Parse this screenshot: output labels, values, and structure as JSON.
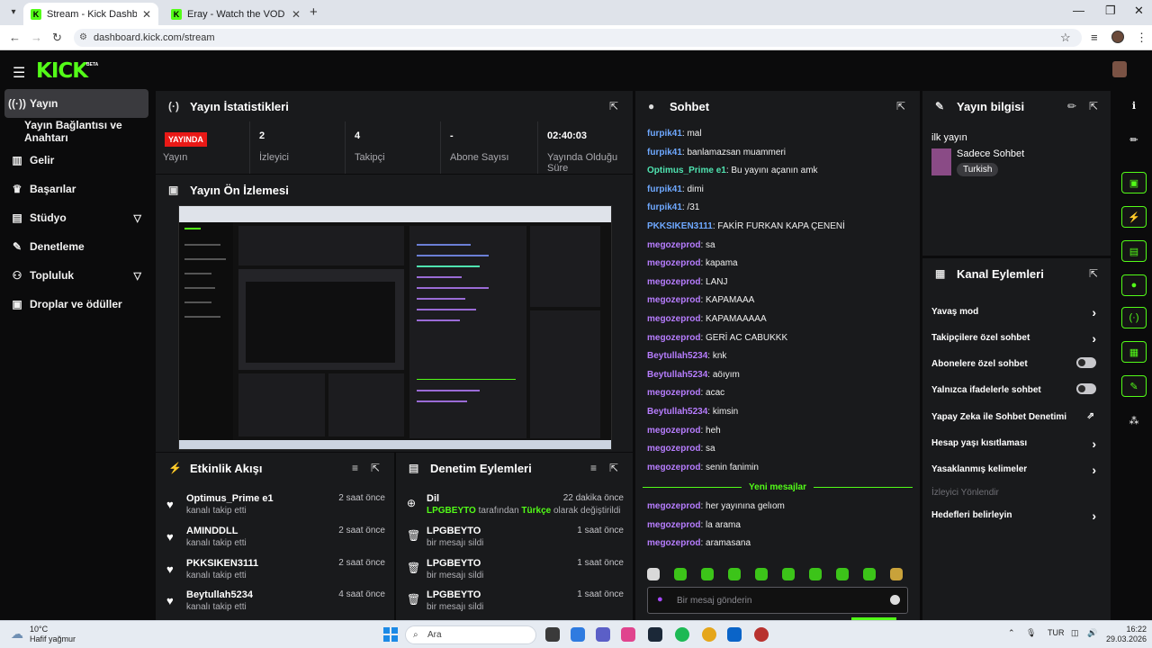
{
  "browser": {
    "tabs": [
      {
        "title": "Stream - Kick Dashboard"
      },
      {
        "title": "Eray - Watch the VOD on Kick"
      }
    ],
    "url": "dashboard.kick.com/stream"
  },
  "brand": {
    "logo": "KICK",
    "badge": "BETA",
    "accent": "#53fc18"
  },
  "sidebar": {
    "items": [
      {
        "label": "Yayın",
        "icon": "broadcast-icon"
      },
      {
        "label": "Yayın Bağlantısı ve Anahtarı"
      },
      {
        "label": "Gelir",
        "icon": "chart-icon"
      },
      {
        "label": "Başarılar",
        "icon": "trophy-icon"
      },
      {
        "label": "Stüdyo",
        "icon": "studio-icon"
      },
      {
        "label": "Denetleme",
        "icon": "wrench-icon"
      },
      {
        "label": "Topluluk",
        "icon": "community-icon"
      },
      {
        "label": "Droplar ve ödüller",
        "icon": "gift-icon"
      }
    ]
  },
  "stats": {
    "title": "Yayın İstatistikleri",
    "live_badge": "YAYINDA",
    "live_label": "Yayın",
    "viewers": "2",
    "viewers_label": "İzleyici",
    "followers": "4",
    "followers_label": "Takipçi",
    "subs": "-",
    "subs_label": "Abone Sayısı",
    "duration": "02:40:03",
    "duration_label": "Yayında Olduğu Süre"
  },
  "preview": {
    "title": "Yayın Ön İzlemesi"
  },
  "activity": {
    "title": "Etkinlik Akışı",
    "items": [
      {
        "name": "Optimus_Prime e1",
        "sub": "kanalı takip etti",
        "time": "2 saat önce"
      },
      {
        "name": "AMINDDLL",
        "sub": "kanalı takip etti",
        "time": "2 saat önce"
      },
      {
        "name": "PKKSIKEN3111",
        "sub": "kanalı takip etti",
        "time": "2 saat önce"
      },
      {
        "name": "Beytullah5234",
        "sub": "kanalı takip etti",
        "time": "4 saat önce"
      }
    ]
  },
  "moderation": {
    "title": "Denetim Eylemleri",
    "items": [
      {
        "name": "Dil",
        "user": "LPGBEYTO",
        "mid": " tarafından ",
        "lang": "Türkçe",
        "end": " olarak değiştirildi",
        "time": "22 dakika önce"
      },
      {
        "name": "LPGBEYTO",
        "sub": "bir mesajı sildi",
        "time": "1 saat önce"
      },
      {
        "name": "LPGBEYTO",
        "sub": "bir mesajı sildi",
        "time": "1 saat önce"
      },
      {
        "name": "LPGBEYTO",
        "sub": "bir mesajı sildi",
        "time": "1 saat önce"
      }
    ]
  },
  "chat": {
    "title": "Sohbet",
    "messages": [
      {
        "user": "furpik41",
        "color": "#6ea8ff",
        "text": ": mal"
      },
      {
        "user": "furpik41",
        "color": "#6ea8ff",
        "text": ": banlamazsan muammeri"
      },
      {
        "user": "Optimus_Prime e1",
        "color": "#4fe3b0",
        "text": ": Bu yayını açanın amk"
      },
      {
        "user": "furpik41",
        "color": "#6ea8ff",
        "text": ": dimi"
      },
      {
        "user": "furpik41",
        "color": "#6ea8ff",
        "text": ": /31"
      },
      {
        "user": "PKKSIKEN3111",
        "color": "#6ea8ff",
        "text": ": FAKİR FURKAN KAPA ÇENENİ"
      },
      {
        "user": "megozeprod",
        "color": "#b77dff",
        "text": ": sa"
      },
      {
        "user": "megozeprod",
        "color": "#b77dff",
        "text": ": kapama"
      },
      {
        "user": "megozeprod",
        "color": "#b77dff",
        "text": ": LANJ"
      },
      {
        "user": "megozeprod",
        "color": "#b77dff",
        "text": ": KAPAMAAA"
      },
      {
        "user": "megozeprod",
        "color": "#b77dff",
        "text": ": KAPAMAAAAA"
      },
      {
        "user": "megozeprod",
        "color": "#b77dff",
        "text": ": GERİ AC CABUKKK"
      },
      {
        "user": "Beytullah5234",
        "color": "#b77dff",
        "text": ": knk"
      },
      {
        "user": "Beytullah5234",
        "color": "#b77dff",
        "text": ": aöıyım"
      },
      {
        "user": "megozeprod",
        "color": "#b77dff",
        "text": ": acac"
      },
      {
        "user": "Beytullah5234",
        "color": "#b77dff",
        "text": ": kimsin"
      },
      {
        "user": "megozeprod",
        "color": "#b77dff",
        "text": ": heh"
      },
      {
        "user": "megozeprod",
        "color": "#b77dff",
        "text": ": sa"
      },
      {
        "user": "megozeprod",
        "color": "#b77dff",
        "text": ": senin fanimin"
      }
    ],
    "new_messages_label": "Yeni mesajlar",
    "new_messages": [
      {
        "user": "megozeprod",
        "color": "#b77dff",
        "text": ": her yayınına gelıom"
      },
      {
        "user": "megozeprod",
        "color": "#b77dff",
        "text": ": la arama"
      },
      {
        "user": "megozeprod",
        "color": "#b77dff",
        "text": ": aramasana"
      }
    ],
    "input_placeholder": "Bir mesaj gönderin"
  },
  "stream_info": {
    "title": "Yayın bilgisi",
    "stream_title": "ilk yayın",
    "category": "Sadece Sohbet",
    "tag": "Turkish"
  },
  "channel_actions": {
    "title": "Kanal Eylemleri",
    "items": [
      {
        "label": "Yavaş mod",
        "kind": "arrow"
      },
      {
        "label": "Takipçilere özel sohbet",
        "kind": "arrow"
      },
      {
        "label": "Abonelere özel sohbet",
        "kind": "toggle"
      },
      {
        "label": "Yalnızca ifadelerle sohbet",
        "kind": "toggle"
      },
      {
        "label": "Yapay Zeka ile Sohbet Denetimi",
        "kind": "external"
      },
      {
        "label": "Hesap yaşı kısıtlaması",
        "kind": "arrow"
      },
      {
        "label": "Yasaklanmış kelimeler",
        "kind": "arrow"
      },
      {
        "label": "İzleyici Yönlendir",
        "kind": "disabled"
      },
      {
        "label": "Hedefleri belirleyin",
        "kind": "arrow"
      }
    ]
  },
  "taskbar": {
    "temp": "10°C",
    "weather": "Hafif yağmur",
    "search": "Ara",
    "lang": "TUR",
    "time": "16:22",
    "date": "29.03.2026"
  }
}
